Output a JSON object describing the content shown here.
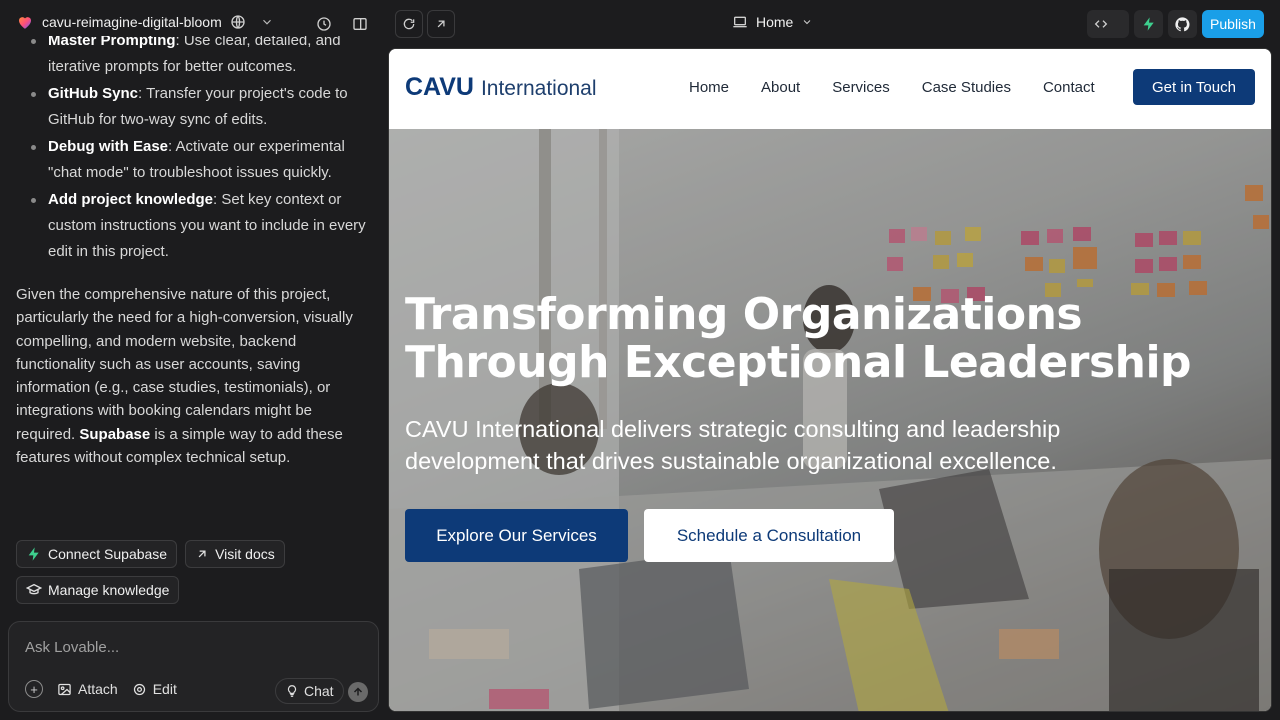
{
  "header": {
    "project_name": "cavu-reimagine-digital-bloom",
    "route": "Home",
    "publish_label": "Publish"
  },
  "chat": {
    "tips": [
      {
        "title": "Master Prompting",
        "text": ": Use clear, detailed, and iterative prompts for better outcomes."
      },
      {
        "title": "GitHub Sync",
        "text": ": Transfer your project's code to GitHub for two-way sync of edits."
      },
      {
        "title": "Debug with Ease",
        "text": ": Activate our experimental \"chat mode\" to troubleshoot issues quickly."
      },
      {
        "title": "Add project knowledge",
        "text": ": Set key context or custom instructions you want to include in every edit in this project."
      }
    ],
    "paragraph_before": "Given the comprehensive nature of this project, particularly the need for a high-conversion, visually compelling, and modern website, backend functionality such as user accounts, saving information (e.g., case studies, testimonials), or integrations with booking calendars might be required. ",
    "paragraph_bold": "Supabase",
    "paragraph_after": " is a simple way to add these features without complex technical setup.",
    "buttons": {
      "connect": "Connect Supabase",
      "docs": "Visit docs",
      "knowledge": "Manage knowledge"
    },
    "input": {
      "placeholder": "Ask Lovable...",
      "attach": "Attach",
      "edit": "Edit",
      "chat": "Chat"
    }
  },
  "preview": {
    "logo_bold": "CAVU",
    "logo_sub": "International",
    "nav": [
      "Home",
      "About",
      "Services",
      "Case Studies",
      "Contact"
    ],
    "cta": "Get in Touch",
    "hero": {
      "title_line1": "Transforming Organizations",
      "title_line2": "Through Exceptional Leadership",
      "lead": "CAVU International delivers strategic consulting and leadership development that drives sustainable organizational excellence.",
      "primary_button": "Explore Our Services",
      "secondary_button": "Schedule a Consultation"
    }
  },
  "colors": {
    "brand_navy": "#0d3a78",
    "publish_blue": "#1a9fe8",
    "supabase_green": "#3ecf8e"
  }
}
